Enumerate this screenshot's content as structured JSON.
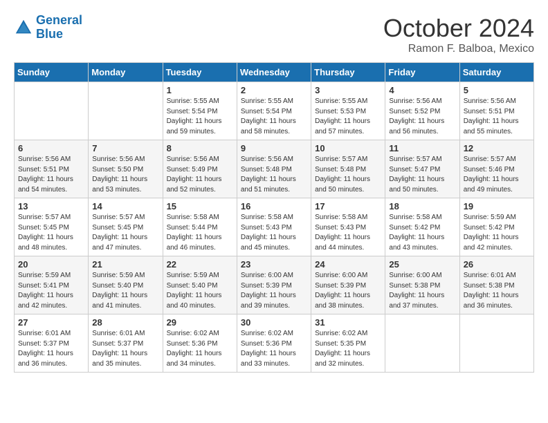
{
  "header": {
    "logo_line1": "General",
    "logo_line2": "Blue",
    "month_title": "October 2024",
    "subtitle": "Ramon F. Balboa, Mexico"
  },
  "weekdays": [
    "Sunday",
    "Monday",
    "Tuesday",
    "Wednesday",
    "Thursday",
    "Friday",
    "Saturday"
  ],
  "weeks": [
    [
      {
        "day": "",
        "info": ""
      },
      {
        "day": "",
        "info": ""
      },
      {
        "day": "1",
        "info": "Sunrise: 5:55 AM\nSunset: 5:54 PM\nDaylight: 11 hours and 59 minutes."
      },
      {
        "day": "2",
        "info": "Sunrise: 5:55 AM\nSunset: 5:54 PM\nDaylight: 11 hours and 58 minutes."
      },
      {
        "day": "3",
        "info": "Sunrise: 5:55 AM\nSunset: 5:53 PM\nDaylight: 11 hours and 57 minutes."
      },
      {
        "day": "4",
        "info": "Sunrise: 5:56 AM\nSunset: 5:52 PM\nDaylight: 11 hours and 56 minutes."
      },
      {
        "day": "5",
        "info": "Sunrise: 5:56 AM\nSunset: 5:51 PM\nDaylight: 11 hours and 55 minutes."
      }
    ],
    [
      {
        "day": "6",
        "info": "Sunrise: 5:56 AM\nSunset: 5:51 PM\nDaylight: 11 hours and 54 minutes."
      },
      {
        "day": "7",
        "info": "Sunrise: 5:56 AM\nSunset: 5:50 PM\nDaylight: 11 hours and 53 minutes."
      },
      {
        "day": "8",
        "info": "Sunrise: 5:56 AM\nSunset: 5:49 PM\nDaylight: 11 hours and 52 minutes."
      },
      {
        "day": "9",
        "info": "Sunrise: 5:56 AM\nSunset: 5:48 PM\nDaylight: 11 hours and 51 minutes."
      },
      {
        "day": "10",
        "info": "Sunrise: 5:57 AM\nSunset: 5:48 PM\nDaylight: 11 hours and 50 minutes."
      },
      {
        "day": "11",
        "info": "Sunrise: 5:57 AM\nSunset: 5:47 PM\nDaylight: 11 hours and 50 minutes."
      },
      {
        "day": "12",
        "info": "Sunrise: 5:57 AM\nSunset: 5:46 PM\nDaylight: 11 hours and 49 minutes."
      }
    ],
    [
      {
        "day": "13",
        "info": "Sunrise: 5:57 AM\nSunset: 5:45 PM\nDaylight: 11 hours and 48 minutes."
      },
      {
        "day": "14",
        "info": "Sunrise: 5:57 AM\nSunset: 5:45 PM\nDaylight: 11 hours and 47 minutes."
      },
      {
        "day": "15",
        "info": "Sunrise: 5:58 AM\nSunset: 5:44 PM\nDaylight: 11 hours and 46 minutes."
      },
      {
        "day": "16",
        "info": "Sunrise: 5:58 AM\nSunset: 5:43 PM\nDaylight: 11 hours and 45 minutes."
      },
      {
        "day": "17",
        "info": "Sunrise: 5:58 AM\nSunset: 5:43 PM\nDaylight: 11 hours and 44 minutes."
      },
      {
        "day": "18",
        "info": "Sunrise: 5:58 AM\nSunset: 5:42 PM\nDaylight: 11 hours and 43 minutes."
      },
      {
        "day": "19",
        "info": "Sunrise: 5:59 AM\nSunset: 5:42 PM\nDaylight: 11 hours and 42 minutes."
      }
    ],
    [
      {
        "day": "20",
        "info": "Sunrise: 5:59 AM\nSunset: 5:41 PM\nDaylight: 11 hours and 42 minutes."
      },
      {
        "day": "21",
        "info": "Sunrise: 5:59 AM\nSunset: 5:40 PM\nDaylight: 11 hours and 41 minutes."
      },
      {
        "day": "22",
        "info": "Sunrise: 5:59 AM\nSunset: 5:40 PM\nDaylight: 11 hours and 40 minutes."
      },
      {
        "day": "23",
        "info": "Sunrise: 6:00 AM\nSunset: 5:39 PM\nDaylight: 11 hours and 39 minutes."
      },
      {
        "day": "24",
        "info": "Sunrise: 6:00 AM\nSunset: 5:39 PM\nDaylight: 11 hours and 38 minutes."
      },
      {
        "day": "25",
        "info": "Sunrise: 6:00 AM\nSunset: 5:38 PM\nDaylight: 11 hours and 37 minutes."
      },
      {
        "day": "26",
        "info": "Sunrise: 6:01 AM\nSunset: 5:38 PM\nDaylight: 11 hours and 36 minutes."
      }
    ],
    [
      {
        "day": "27",
        "info": "Sunrise: 6:01 AM\nSunset: 5:37 PM\nDaylight: 11 hours and 36 minutes."
      },
      {
        "day": "28",
        "info": "Sunrise: 6:01 AM\nSunset: 5:37 PM\nDaylight: 11 hours and 35 minutes."
      },
      {
        "day": "29",
        "info": "Sunrise: 6:02 AM\nSunset: 5:36 PM\nDaylight: 11 hours and 34 minutes."
      },
      {
        "day": "30",
        "info": "Sunrise: 6:02 AM\nSunset: 5:36 PM\nDaylight: 11 hours and 33 minutes."
      },
      {
        "day": "31",
        "info": "Sunrise: 6:02 AM\nSunset: 5:35 PM\nDaylight: 11 hours and 32 minutes."
      },
      {
        "day": "",
        "info": ""
      },
      {
        "day": "",
        "info": ""
      }
    ]
  ]
}
